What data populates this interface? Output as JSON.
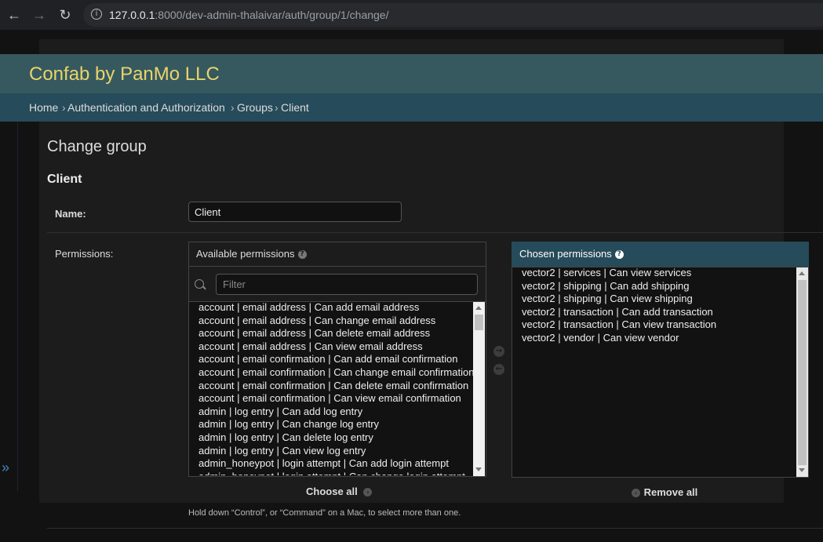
{
  "browser": {
    "url_host": "127.0.0.1",
    "url_rest": ":8000/dev-admin-thalaivar/auth/group/1/change/",
    "back_icon": "←",
    "forward_icon": "→",
    "reload_icon": "↻",
    "info_icon": "i"
  },
  "site": {
    "title": "Confab by PanMo LLC"
  },
  "breadcrumbs": {
    "home": "Home",
    "app": "Authentication and Authorization",
    "model": "Groups",
    "current": "Client",
    "separator": "›"
  },
  "page": {
    "title": "Change group",
    "object_title": "Client"
  },
  "form": {
    "name_label": "Name:",
    "name_value": "Client",
    "permissions_label": "Permissions:"
  },
  "available": {
    "title": "Available permissions",
    "filter_placeholder": "Filter",
    "items": [
      "account | email address | Can add email address",
      "account | email address | Can change email address",
      "account | email address | Can delete email address",
      "account | email address | Can view email address",
      "account | email confirmation | Can add email confirmation",
      "account | email confirmation | Can change email confirmation",
      "account | email confirmation | Can delete email confirmation",
      "account | email confirmation | Can view email confirmation",
      "admin | log entry | Can add log entry",
      "admin | log entry | Can change log entry",
      "admin | log entry | Can delete log entry",
      "admin | log entry | Can view log entry",
      "admin_honeypot | login attempt | Can add login attempt",
      "admin_honeypot | login attempt | Can change login attempt"
    ]
  },
  "chosen": {
    "title": "Chosen permissions",
    "items": [
      "vector2 | services | Can view services",
      "vector2 | shipping | Can add shipping",
      "vector2 | shipping | Can view shipping",
      "vector2 | transaction | Can add transaction",
      "vector2 | transaction | Can view transaction",
      "vector2 | vendor | Can view vendor"
    ]
  },
  "actions": {
    "choose_all": "Choose all",
    "remove_all": "Remove all",
    "add_icon": "→",
    "remove_icon": "←",
    "choose_all_icon": "›",
    "remove_all_icon": "‹"
  },
  "help_text": "Hold down “Control”, or “Command” on a Mac, to select more than one.",
  "sidebar_toggle": "»",
  "help_icon": "?",
  "colors": {
    "header": "#36595f",
    "breadcrumbs": "#264b5a",
    "title": "#e8d46b",
    "chosen_header": "#264b5a"
  }
}
